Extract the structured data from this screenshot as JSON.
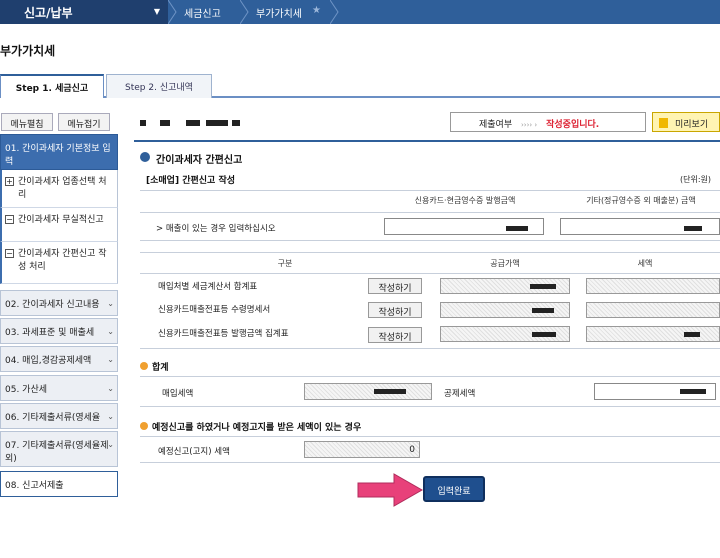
{
  "topbar": {
    "menu_label": "신고/납부",
    "breadcrumbs": [
      "세금신고",
      "부가가치세"
    ]
  },
  "page": {
    "title": "부가가치세"
  },
  "tabs": [
    {
      "label": "Step 1. 세금신고",
      "active": true
    },
    {
      "label": "Step 2. 신고내역",
      "active": false
    }
  ],
  "sidebar": {
    "expand_label": "메뉴펼침",
    "collapse_label": "메뉴접기",
    "first_item": "01. 간이과세자 기본정보 입력",
    "sub_items": [
      "간이과세자 업종선택 처리",
      "간이과세자 무실적신고",
      "간이과세자 간편신고 작성 처리"
    ],
    "items": [
      "02. 간이과세자 신고내용",
      "03. 과세표준 및 매출세",
      "04. 매입,경감공제세액",
      "05. 가산세",
      "06. 기타제출서류(영세율",
      "07. 기타제출서류(영세율제외)",
      "08. 신고서제출"
    ]
  },
  "status": {
    "label": "제출여부",
    "arrows": "›››› ›",
    "value": "작성중입니다.",
    "preview": "미리보기"
  },
  "form": {
    "section_title": "간이과세자 간편신고",
    "sub_title": "[소매업] 간편신고 작성",
    "unit": "(단위:원)",
    "col_card": "신용카드·현금영수증 발행금액",
    "col_other": "기타(정규영수증 외 매출분) 금액",
    "row_sales": "> 매출이 있는 경우 입력하십시오",
    "table2_col1": "구분",
    "table2_col2": "공급가액",
    "table2_col3": "세액",
    "rows": [
      "매입처별 세금계산서 합계표",
      "신용카드매출전표등 수령명세서",
      "신용카드매출전표등 발행금액 집계표"
    ],
    "write_label": "작성하기",
    "total_title": "합계",
    "purchase_tax": "매입세액",
    "deduct_tax": "공제세액",
    "prelim_title": "예정신고를 하였거나 예정고지를 받은 세액이 있는 경우",
    "prelim_label": "예정신고(고지) 세액",
    "prelim_value": "0",
    "submit": "입력완료"
  },
  "colors": {
    "accent": "#2f5f9a",
    "status_red": "#dd2233",
    "arrow_pink": "#e8417a"
  }
}
